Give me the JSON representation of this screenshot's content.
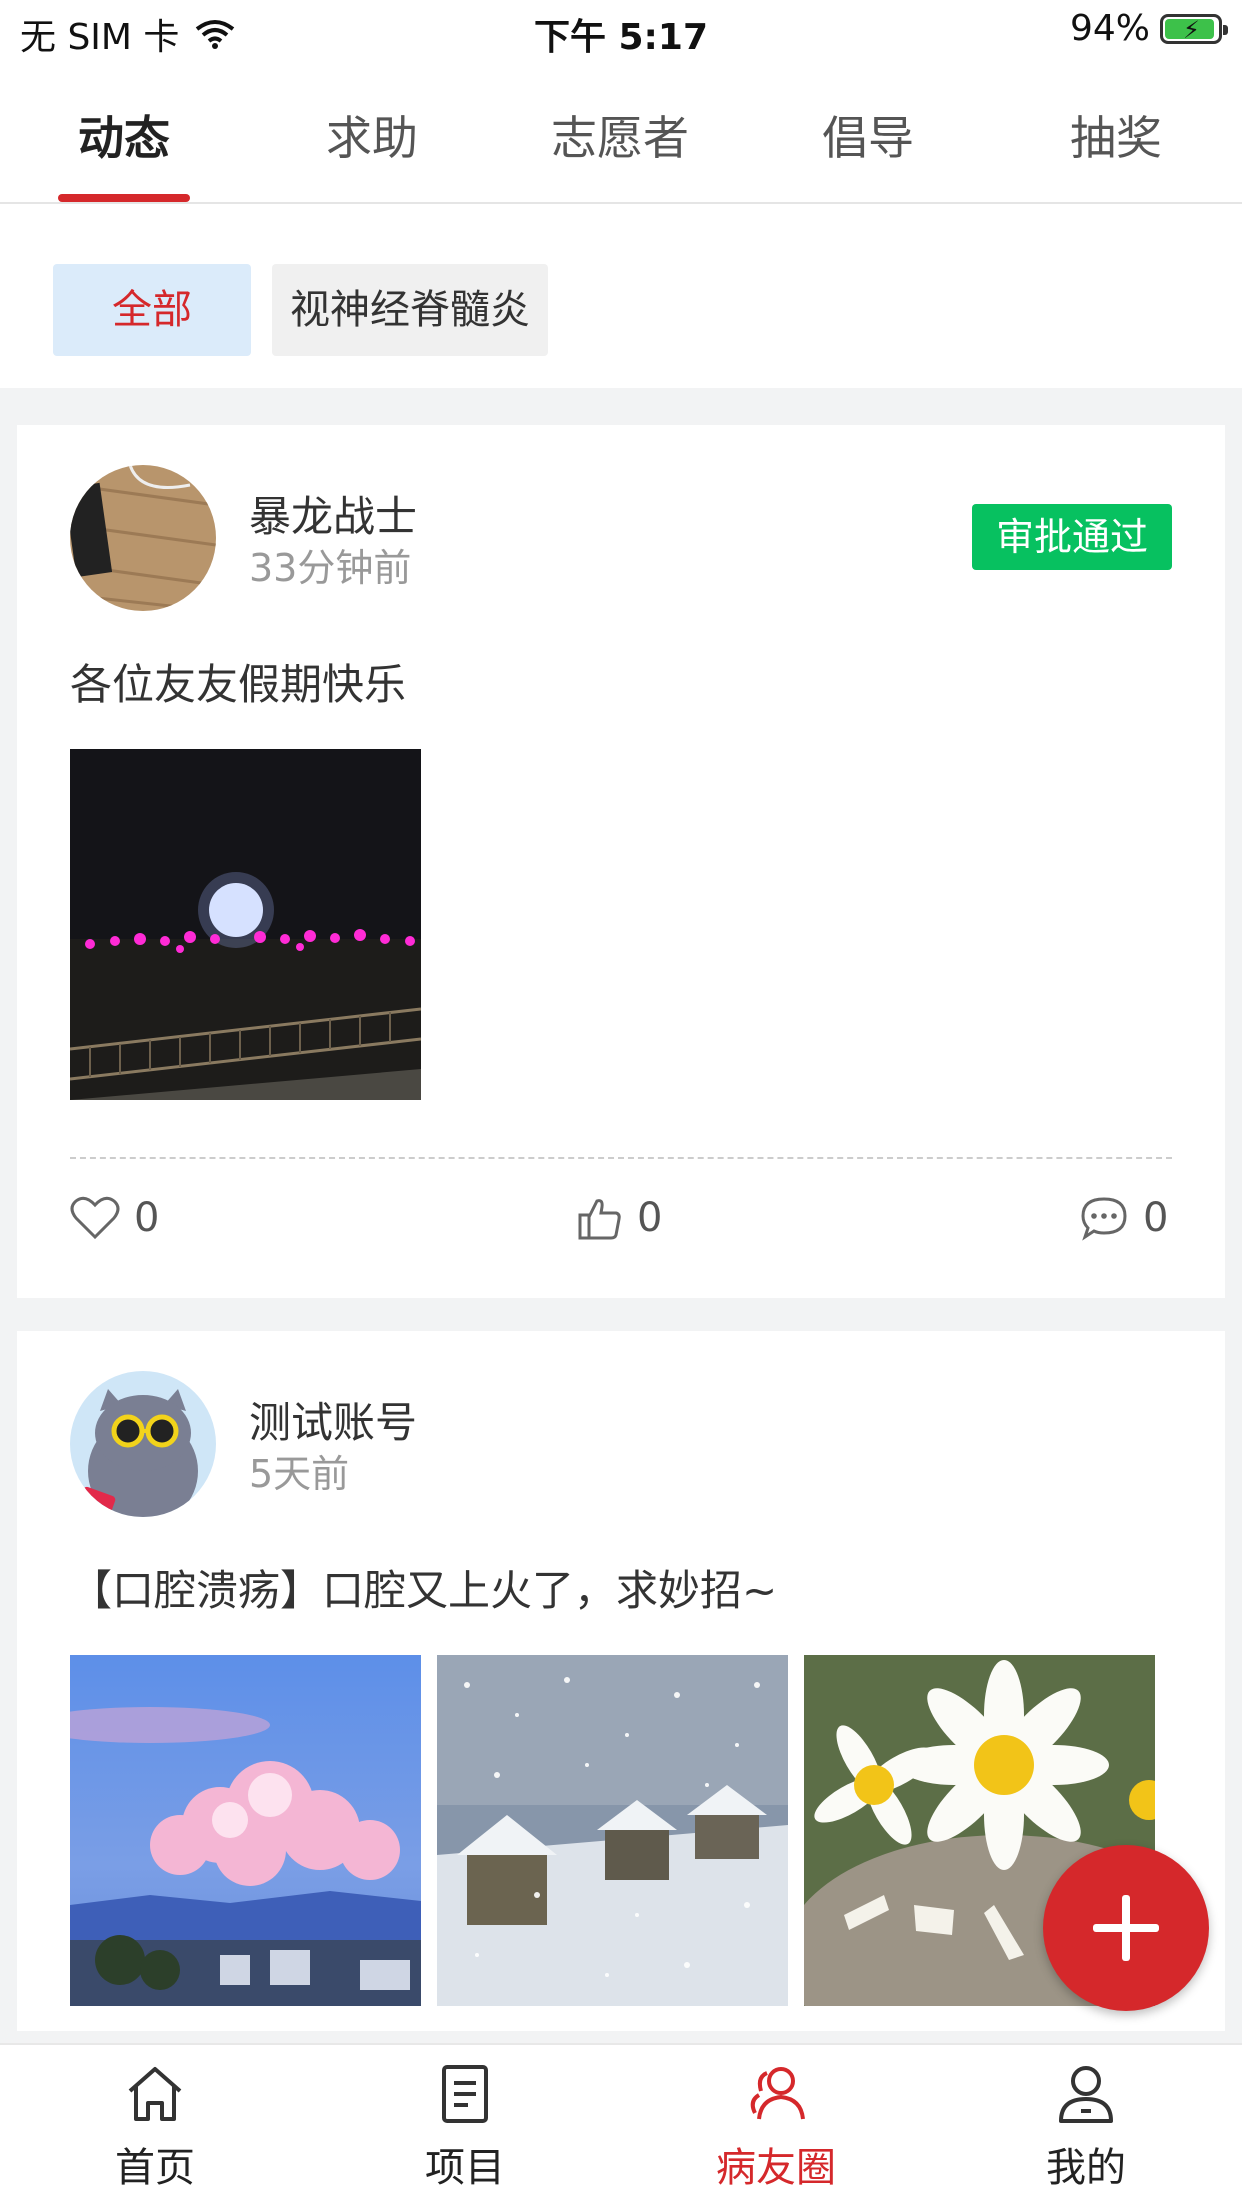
{
  "status_bar": {
    "carrier": "无 SIM 卡",
    "time": "下午 5:17",
    "battery": "94%",
    "battery_level": 0.94
  },
  "tabs": [
    {
      "label": "动态",
      "active": true
    },
    {
      "label": "求助",
      "active": false
    },
    {
      "label": "志愿者",
      "active": false
    },
    {
      "label": "倡导",
      "active": false
    },
    {
      "label": "抽奖",
      "active": false
    }
  ],
  "filters": [
    {
      "label": "全部",
      "active": true
    },
    {
      "label": "视神经脊髓炎",
      "active": false
    }
  ],
  "posts": [
    {
      "author": "暴龙战士",
      "time": "33分钟前",
      "status": "审批通过",
      "text": "各位友友假期快乐",
      "images": [
        "night-park-photo"
      ],
      "likes": "0",
      "thumbs": "0",
      "comments": "0"
    },
    {
      "author": "测试账号",
      "time": "5天前",
      "text": "【口腔溃疡】口腔又上火了，求妙招~",
      "images": [
        "pink-clouds-photo",
        "snowy-village-photo",
        "daisies-photo"
      ]
    }
  ],
  "bottom_nav": [
    {
      "label": "首页",
      "icon": "home-icon",
      "active": false
    },
    {
      "label": "项目",
      "icon": "document-icon",
      "active": false
    },
    {
      "label": "病友圈",
      "icon": "community-icon",
      "active": true
    },
    {
      "label": "我的",
      "icon": "user-icon",
      "active": false
    }
  ],
  "colors": {
    "accent": "#d5282b",
    "approved": "#07c160",
    "chip_active_bg": "#dbebfa"
  }
}
